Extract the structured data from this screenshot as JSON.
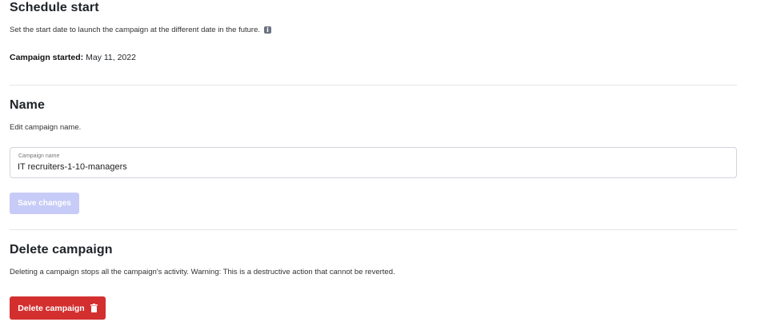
{
  "schedule": {
    "title": "Schedule start",
    "description": "Set the start date to launch the campaign at the different date in the future.",
    "info_icon": "info-icon",
    "started_label": "Campaign started:",
    "started_value": "May 11, 2022"
  },
  "name": {
    "title": "Name",
    "description": "Edit campaign name.",
    "field_label": "Campaign name",
    "field_value": "IT recruiters-1-10-managers",
    "save_label": "Save changes"
  },
  "delete": {
    "title": "Delete campaign",
    "description": "Deleting a campaign stops all the campaign's activity. Warning: This is a destructive action that cannot be reverted.",
    "button_label": "Delete campaign",
    "button_icon": "trash-icon"
  },
  "colors": {
    "save_disabled": "#c7cbf7",
    "delete": "#d32f2f",
    "divider": "#e5e7eb"
  }
}
